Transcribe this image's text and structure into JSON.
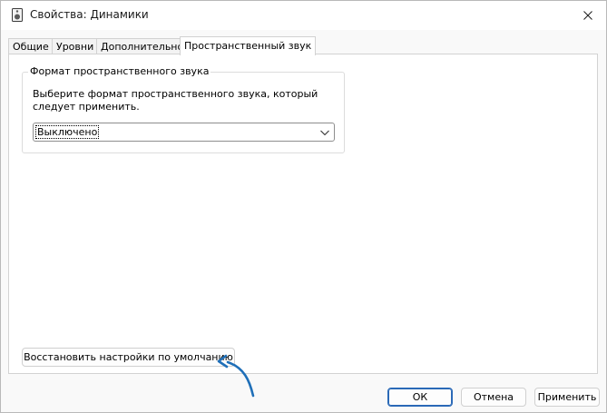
{
  "window": {
    "title": "Свойства: Динамики"
  },
  "tabs": [
    {
      "label": "Общие",
      "active": false
    },
    {
      "label": "Уровни",
      "active": false
    },
    {
      "label": "Дополнительно",
      "active": false
    },
    {
      "label": "Пространственный звук",
      "active": true
    }
  ],
  "spatial": {
    "group_title": "Формат пространственного звука",
    "description": "Выберите формат пространственного звука, который следует применить.",
    "format_selected": "Выключено"
  },
  "buttons": {
    "restore_label": "Восстановить настройки по умолчанию",
    "ok_label": "ОК",
    "cancel_label": "Отмена",
    "apply_label": "Применить"
  },
  "colors": {
    "accent": "#2a69b7",
    "annotation_arrow": "#1f6fb8"
  },
  "icons": {
    "title": "speaker-icon",
    "close": "close-icon",
    "dropdown": "chevron-down-icon",
    "annotation": "curved-arrow-icon"
  }
}
